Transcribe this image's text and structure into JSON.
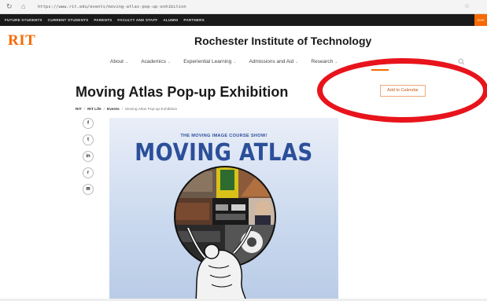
{
  "browser": {
    "url": "https://www.rit.edu/events/moving-atlas-pop-up-exhibition",
    "back_glyph": "↻",
    "home_glyph": "⌂"
  },
  "audience_nav": {
    "items": [
      "FUTURE STUDENTS",
      "CURRENT STUDENTS",
      "PARENTS",
      "FACULTY AND STAFF",
      "ALUMNI",
      "PARTNERS"
    ],
    "cta": "GIVE"
  },
  "header": {
    "logo": "RIT",
    "title": "Rochester Institute of Technology"
  },
  "main_nav": {
    "items": [
      {
        "label": "About"
      },
      {
        "label": "Academics"
      },
      {
        "label": "Experiential Learning"
      },
      {
        "label": "Admissions and Aid"
      },
      {
        "label": "Research"
      }
    ],
    "caret": "⌄"
  },
  "page": {
    "title": "Moving Atlas Pop-up Exhibition",
    "breadcrumb": [
      "RIT",
      "RIT Life",
      "Events",
      "Moving Atlas Pop-up Exhibition"
    ],
    "breadcrumb_sep": "/",
    "add_to_calendar": "Add to Calendar"
  },
  "share": {
    "icons": [
      {
        "name": "facebook-icon",
        "glyph": "f"
      },
      {
        "name": "twitter-icon",
        "glyph": "t"
      },
      {
        "name": "linkedin-icon",
        "glyph": "in"
      },
      {
        "name": "reddit-icon",
        "glyph": "r"
      },
      {
        "name": "email-icon",
        "glyph": "✉"
      }
    ]
  },
  "poster": {
    "subtitle": "THE MOVING IMAGE COURSE SHOW!",
    "title": "MOVING ATLAS"
  },
  "colors": {
    "brand_orange": "#f76902",
    "highlight_red": "#e8141c",
    "poster_blue": "#2c4f9a"
  }
}
